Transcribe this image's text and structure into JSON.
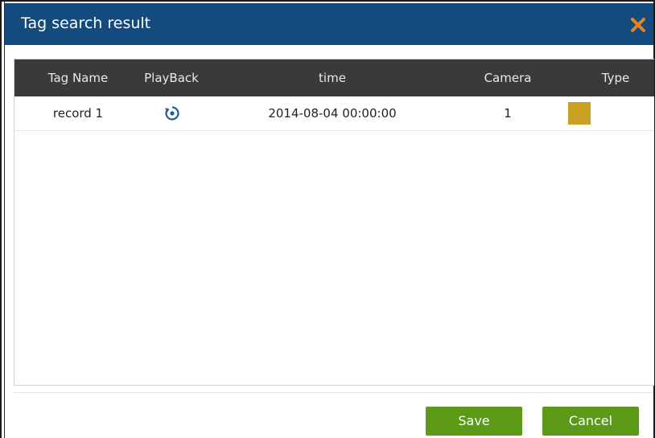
{
  "dialog": {
    "title": "Tag search result",
    "close_icon": "close-icon",
    "header_color": "#134b7e",
    "accent_color": "#e8821e"
  },
  "table": {
    "columns": [
      "Tag Name",
      "PlayBack",
      "time",
      "Camera",
      "Type"
    ],
    "rows": [
      {
        "tag_name": "record 1",
        "playback_icon": "playback-icon",
        "time": "2014-08-04 00:00:00",
        "camera": "1",
        "type_color": "#c9a021"
      }
    ]
  },
  "buttons": {
    "save_label": "Save",
    "cancel_label": "Cancel",
    "button_color": "#5a9a17"
  }
}
